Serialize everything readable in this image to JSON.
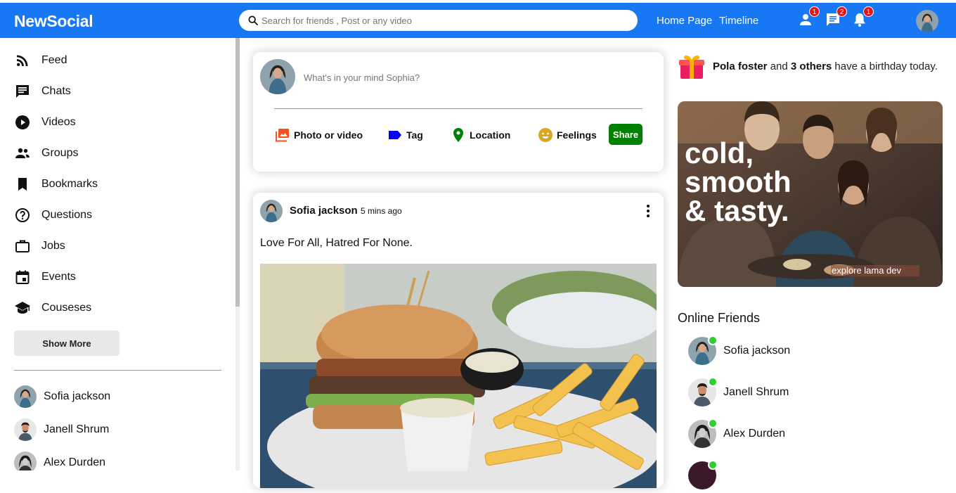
{
  "app": {
    "logo": "NewSocial"
  },
  "topbar": {
    "search_placeholder": "Search for friends , Post or any video",
    "links": [
      "Home Page",
      "Timeline"
    ],
    "notifications": [
      {
        "icon": "person-icon",
        "count": "1"
      },
      {
        "icon": "chat-icon",
        "count": "2"
      },
      {
        "icon": "bell-icon",
        "count": "1"
      }
    ]
  },
  "sidebar": {
    "items": [
      {
        "icon": "rss-feed-icon",
        "label": "Feed"
      },
      {
        "icon": "chat-icon",
        "label": "Chats"
      },
      {
        "icon": "play-circle-icon",
        "label": "Videos"
      },
      {
        "icon": "group-icon",
        "label": "Groups"
      },
      {
        "icon": "bookmark-icon",
        "label": "Bookmarks"
      },
      {
        "icon": "help-outline-icon",
        "label": "Questions"
      },
      {
        "icon": "work-outline-icon",
        "label": "Jobs"
      },
      {
        "icon": "event-icon",
        "label": "Events"
      },
      {
        "icon": "school-icon",
        "label": "Couseses"
      }
    ],
    "show_more": "Show More",
    "friends": [
      "Sofia jackson",
      "Janell Shrum",
      "Alex Durden"
    ]
  },
  "share": {
    "placeholder": "What's in your mind Sophia?",
    "options": [
      {
        "icon": "photo-library-icon",
        "label": "Photo or video",
        "color": "#f4511e"
      },
      {
        "icon": "label-icon",
        "label": "Tag",
        "color": "#0000ff"
      },
      {
        "icon": "room-icon",
        "label": "Location",
        "color": "#008000"
      },
      {
        "icon": "emoji-icon",
        "label": "Feelings",
        "color": "#daa520"
      }
    ],
    "share_button": "Share"
  },
  "post": {
    "username": "Sofia jackson",
    "time": "5 mins ago",
    "text": "Love For All, Hatred For None."
  },
  "rightbar": {
    "birthday": {
      "name": "Pola foster",
      "middle": " and ",
      "others": "3 others",
      "suffix": " have a birthday today."
    },
    "ad": {
      "headline": [
        "cold,",
        "smooth",
        "& tasty."
      ],
      "caption": "explore lama dev"
    },
    "online_title": "Online Friends",
    "online_friends": [
      "Sofia jackson",
      "Janell Shrum",
      "Alex Durden"
    ]
  },
  "colors": {
    "brand": "#1877f2",
    "badge": "#e4141a",
    "online": "#32cd32",
    "share_button": "#008000"
  }
}
